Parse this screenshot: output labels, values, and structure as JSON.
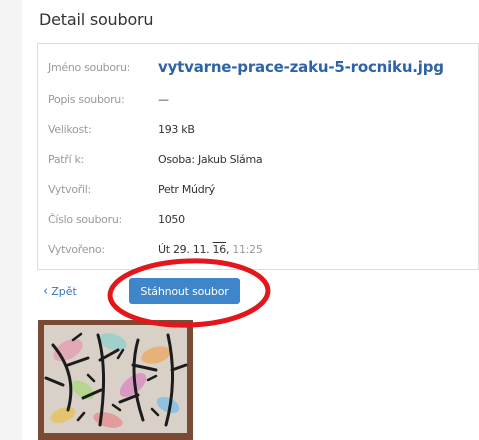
{
  "detail": {
    "title": "Detail souboru",
    "rows": [
      {
        "label": "Jméno souboru:",
        "value": "vytvarne-prace-zaku-5-rocniku.jpg"
      },
      {
        "label": "Popis souboru:",
        "value": "—"
      },
      {
        "label": "Velikost:",
        "value": "193 kB"
      },
      {
        "label": "Patří k:",
        "value": "Osoba: Jakub Sláma"
      },
      {
        "label": "Vytvořil:",
        "value": "Petr Múdrý"
      },
      {
        "label": "Číslo souboru:",
        "value": "1050"
      },
      {
        "label": "Vytvořeno:",
        "value_prefix": "Út 29. 11. ",
        "value_year": "16",
        "value_sep": ", ",
        "value_time": "11:25"
      }
    ]
  },
  "actions": {
    "back_label": "Zpět",
    "back_icon": "chevron-left-icon",
    "download_label": "Stáhnout soubor"
  },
  "annotation": {
    "color": "#e3161c"
  }
}
